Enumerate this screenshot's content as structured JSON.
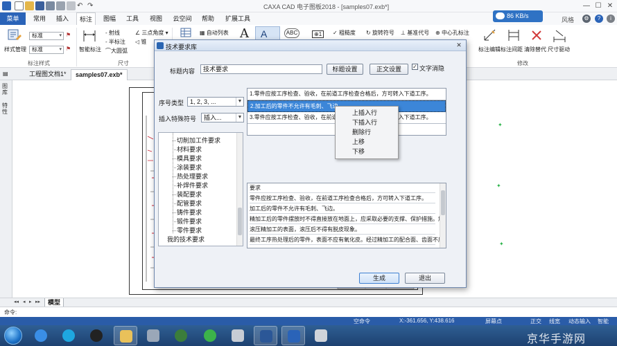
{
  "app": {
    "title": "CAXA CAD 电子图板2018 - [samples07.exb*]",
    "network_speed": "86 KB/s",
    "style_menu": "风格"
  },
  "ribbon": {
    "menu_button": "菜单",
    "tabs": [
      "常用",
      "插入",
      "标注",
      "图幅",
      "工具",
      "视图",
      "云空间",
      "帮助",
      "扩展工具"
    ],
    "active_tab": "标注",
    "style_manage": "样式管理",
    "style_combo_1": "标准",
    "style_combo_2": "标准",
    "group_style": "标注样式",
    "smart_dim": "智能标注",
    "small_items": [
      "射线",
      "半标注",
      "大圆弧",
      "三点角度",
      "锥"
    ],
    "group_size": "尺寸",
    "auto_list": "自动列表",
    "rough": "粗糙度",
    "rotate_sym": "旋转符号",
    "datum": "基准代号",
    "center_hole": "中心孔标注",
    "edit_dim": "标注编辑",
    "dim_spacing": "标注间距",
    "clear_replace": "清除替代",
    "dim_drive": "尺寸驱动",
    "group_modify": "修改"
  },
  "doc_tabs": [
    "工程图文档1*",
    "samples07.exb*"
  ],
  "left_strip": [
    "图库",
    "特性"
  ],
  "model_tab": "模型",
  "command_prompt": "命令:",
  "status": {
    "cursor_hint": "空命令",
    "coords": "X:-361.656, Y:438.616",
    "snap": "屏幕点",
    "mode1": "正交",
    "mode2": "线宽",
    "mode3": "动态输入",
    "mode4": "智能"
  },
  "dialog": {
    "title": "技术要求库",
    "title_label": "标题内容",
    "title_value": "技术要求",
    "title_settings": "标题设置",
    "body_settings": "正文设置",
    "wrap_label": "文字消隐",
    "wrap_checked": "✓",
    "seq_type_label": "序号类型",
    "seq_type_value": "1, 2, 3, ...",
    "insert_symbol_label": "插入特殊符号",
    "insert_symbol_value": "插入...",
    "tree": {
      "children": [
        "切削加工件要求",
        "材料要求",
        "模具要求",
        "涂装要求",
        "热处理要求",
        "补焊件要求",
        "装配要求",
        "配管要求",
        "铸件要求",
        "锻件要求",
        "零件要求"
      ],
      "root": "我的技术要求"
    },
    "table_rows": [
      "1.零件应按工序检查、验收，在前道工序检查合格后，方可转入下道工序。",
      "2.加工后的零件不允许有毛刺、飞边。",
      "3.零件应按工序检查、验收，在前道工序检查合格后，方可转入下道工序。",
      ""
    ],
    "context_menu": [
      "上插入行",
      "下插入行",
      "删除行",
      "上移",
      "下移"
    ],
    "text_header": "要求",
    "text_lines": [
      "零件应按工序检查、验收，在前道工序检查合格后，方可转入下道工序。",
      "加工后的零件不允许有毛刺、飞边。",
      "精加工后的零件摆放时不得直接放在地面上，应采取必要的支撑、保护措施。加",
      "滚压精加工的表面，滚压后不得有脱皮现象。",
      "最终工序热处理后的零件，表面不应有氧化皮。经过精加工的配合面、齿面不应"
    ],
    "generate": "生成",
    "exit": "退出"
  },
  "taskbar": {
    "watermark": "京华手游网"
  },
  "colors": {
    "accent": "#2a63b8",
    "selection": "#3c86d8",
    "taskbar": "#1d4170"
  }
}
